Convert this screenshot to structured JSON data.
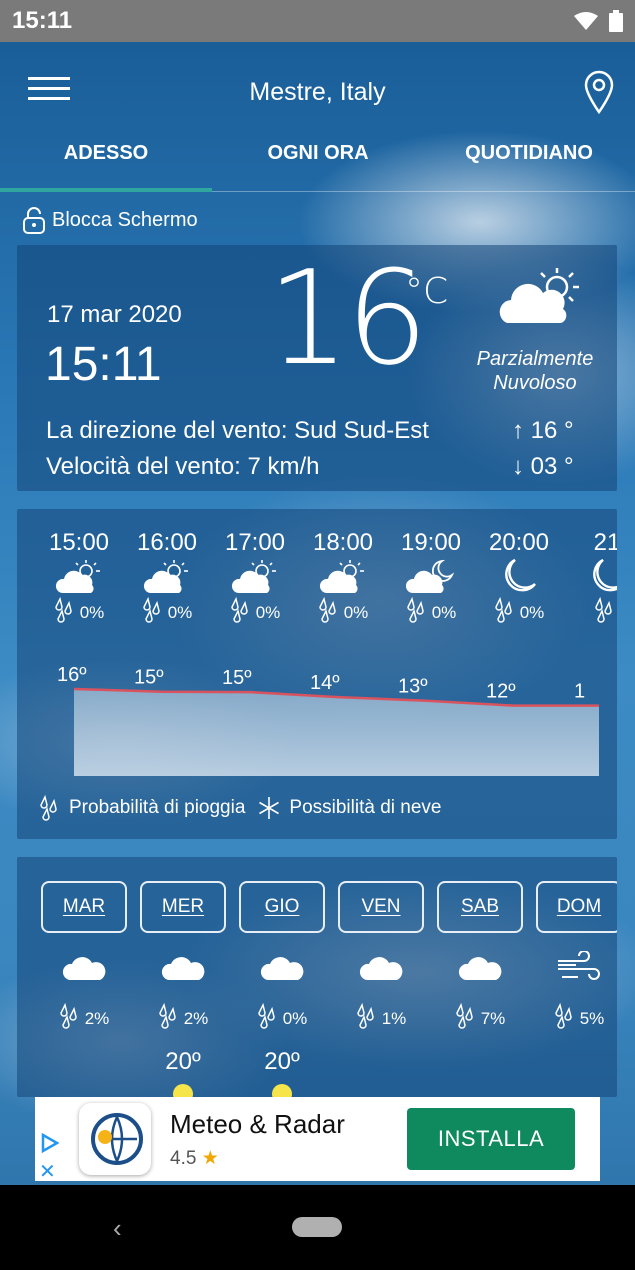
{
  "status_bar": {
    "time": "15:11"
  },
  "app": {
    "city": "Mestre, Italy"
  },
  "tabs": [
    {
      "label": "ADESSO",
      "active": true
    },
    {
      "label": "OGNI ORA",
      "active": false
    },
    {
      "label": "QUOTIDIANO",
      "active": false
    }
  ],
  "lock": {
    "label": "Blocca Schermo"
  },
  "current": {
    "date": "17 mar 2020",
    "time": "15:11",
    "temperature": "16",
    "unit": "°C",
    "condition_line1": "Parzialmente",
    "condition_line2": "Nuvoloso",
    "wind_direction": "La direzione del vento: Sud Sud-Est",
    "wind_speed": "Velocità del vento: 7 km/h",
    "max": "16 °",
    "min": "03 °",
    "icon": "partly-cloudy-day-icon"
  },
  "hourly": [
    {
      "time": "15:00",
      "rain": "0%",
      "temp": "16º",
      "temp_value": 16,
      "icon": "partly-cloudy-day-icon"
    },
    {
      "time": "16:00",
      "rain": "0%",
      "temp": "15º",
      "temp_value": 15.4,
      "icon": "partly-cloudy-day-icon"
    },
    {
      "time": "17:00",
      "rain": "0%",
      "temp": "15º",
      "temp_value": 15.3,
      "icon": "partly-cloudy-day-icon"
    },
    {
      "time": "18:00",
      "rain": "0%",
      "temp": "14º",
      "temp_value": 14.2,
      "icon": "partly-cloudy-day-icon"
    },
    {
      "time": "19:00",
      "rain": "0%",
      "temp": "13º",
      "temp_value": 13.4,
      "icon": "partly-cloudy-night-icon"
    },
    {
      "time": "20:00",
      "rain": "0%",
      "temp": "12º",
      "temp_value": 12.3,
      "icon": "moon-icon"
    },
    {
      "time": "21",
      "rain": "",
      "temp": "1",
      "temp_value": 12.3,
      "icon": "moon-icon"
    }
  ],
  "legend": {
    "rain": "Probabilità di pioggia",
    "snow": "Possibilità di neve"
  },
  "daily": [
    {
      "day": "MAR",
      "rain": "2%",
      "temp": "",
      "icon": "cloud-icon"
    },
    {
      "day": "MER",
      "rain": "2%",
      "temp": "20º",
      "icon": "cloud-icon"
    },
    {
      "day": "GIO",
      "rain": "0%",
      "temp": "20º",
      "icon": "cloud-icon"
    },
    {
      "day": "VEN",
      "rain": "1%",
      "temp": "",
      "icon": "cloud-icon"
    },
    {
      "day": "SAB",
      "rain": "7%",
      "temp": "",
      "icon": "cloud-icon"
    },
    {
      "day": "DOM",
      "rain": "5%",
      "temp": "",
      "icon": "wind-icon"
    }
  ],
  "ad": {
    "title": "Meteo & Radar",
    "rating": "4.5",
    "install": "INSTALLA"
  },
  "colors": {
    "accent": "#2fa6a0",
    "graph_line": "#d9535f",
    "install": "#0f8a5f"
  }
}
